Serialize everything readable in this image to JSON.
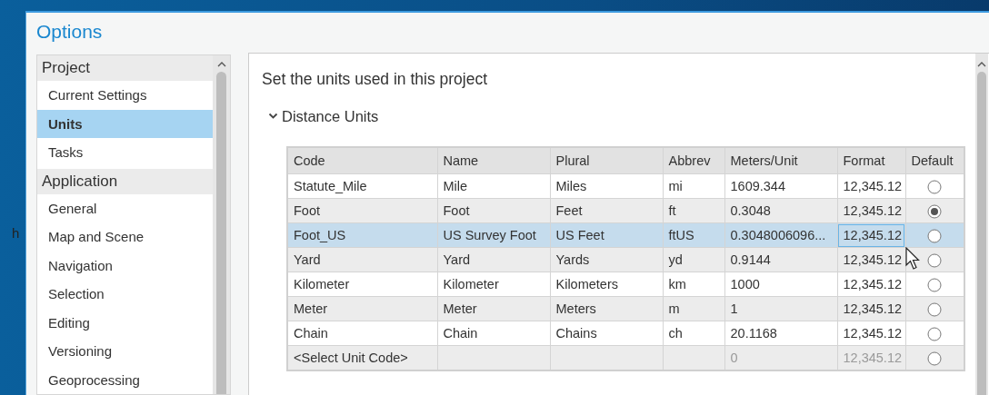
{
  "background_text": "h",
  "window": {
    "title": "Options"
  },
  "sidebar": {
    "groups": [
      {
        "label": "Project",
        "items": [
          {
            "label": "Current Settings",
            "selected": false
          },
          {
            "label": "Units",
            "selected": true
          },
          {
            "label": "Tasks",
            "selected": false
          }
        ]
      },
      {
        "label": "Application",
        "items": [
          {
            "label": "General",
            "selected": false
          },
          {
            "label": "Map and Scene",
            "selected": false
          },
          {
            "label": "Navigation",
            "selected": false
          },
          {
            "label": "Selection",
            "selected": false
          },
          {
            "label": "Editing",
            "selected": false
          },
          {
            "label": "Versioning",
            "selected": false
          },
          {
            "label": "Geoprocessing",
            "selected": false
          }
        ]
      }
    ]
  },
  "content": {
    "heading": "Set the units used in this project",
    "section": {
      "label": "Distance Units",
      "expanded": true
    }
  },
  "table": {
    "columns": [
      "Code",
      "Name",
      "Plural",
      "Abbrev",
      "Meters/Unit",
      "Format",
      "Default"
    ],
    "rows": [
      {
        "kind": "unit",
        "cells": [
          "Statute_Mile",
          "Mile",
          "Miles",
          "mi",
          "1609.344",
          "12,345.12"
        ],
        "default": false,
        "selected": false,
        "format_focused": false
      },
      {
        "kind": "unit",
        "cells": [
          "Foot",
          "Foot",
          "Feet",
          "ft",
          "0.3048",
          "12,345.12"
        ],
        "default": true,
        "selected": false,
        "format_focused": false
      },
      {
        "kind": "unit",
        "cells": [
          "Foot_US",
          "US Survey Foot",
          "US Feet",
          "ftUS",
          "0.3048006096...",
          "12,345.12"
        ],
        "default": false,
        "selected": true,
        "format_focused": true
      },
      {
        "kind": "unit",
        "cells": [
          "Yard",
          "Yard",
          "Yards",
          "yd",
          "0.9144",
          "12,345.12"
        ],
        "default": false,
        "selected": false,
        "format_focused": false
      },
      {
        "kind": "unit",
        "cells": [
          "Kilometer",
          "Kilometer",
          "Kilometers",
          "km",
          "1000",
          "12,345.12"
        ],
        "default": false,
        "selected": false,
        "format_focused": false
      },
      {
        "kind": "unit",
        "cells": [
          "Meter",
          "Meter",
          "Meters",
          "m",
          "1",
          "12,345.12"
        ],
        "default": false,
        "selected": false,
        "format_focused": false
      },
      {
        "kind": "unit",
        "cells": [
          "Chain",
          "Chain",
          "Chains",
          "ch",
          "20.1168",
          "12,345.12"
        ],
        "default": false,
        "selected": false,
        "format_focused": false
      },
      {
        "kind": "new",
        "cells": [
          "<Select Unit Code>",
          "",
          "",
          "",
          "0",
          "12,345.12"
        ],
        "default": false,
        "selected": false,
        "format_focused": false
      }
    ]
  }
}
